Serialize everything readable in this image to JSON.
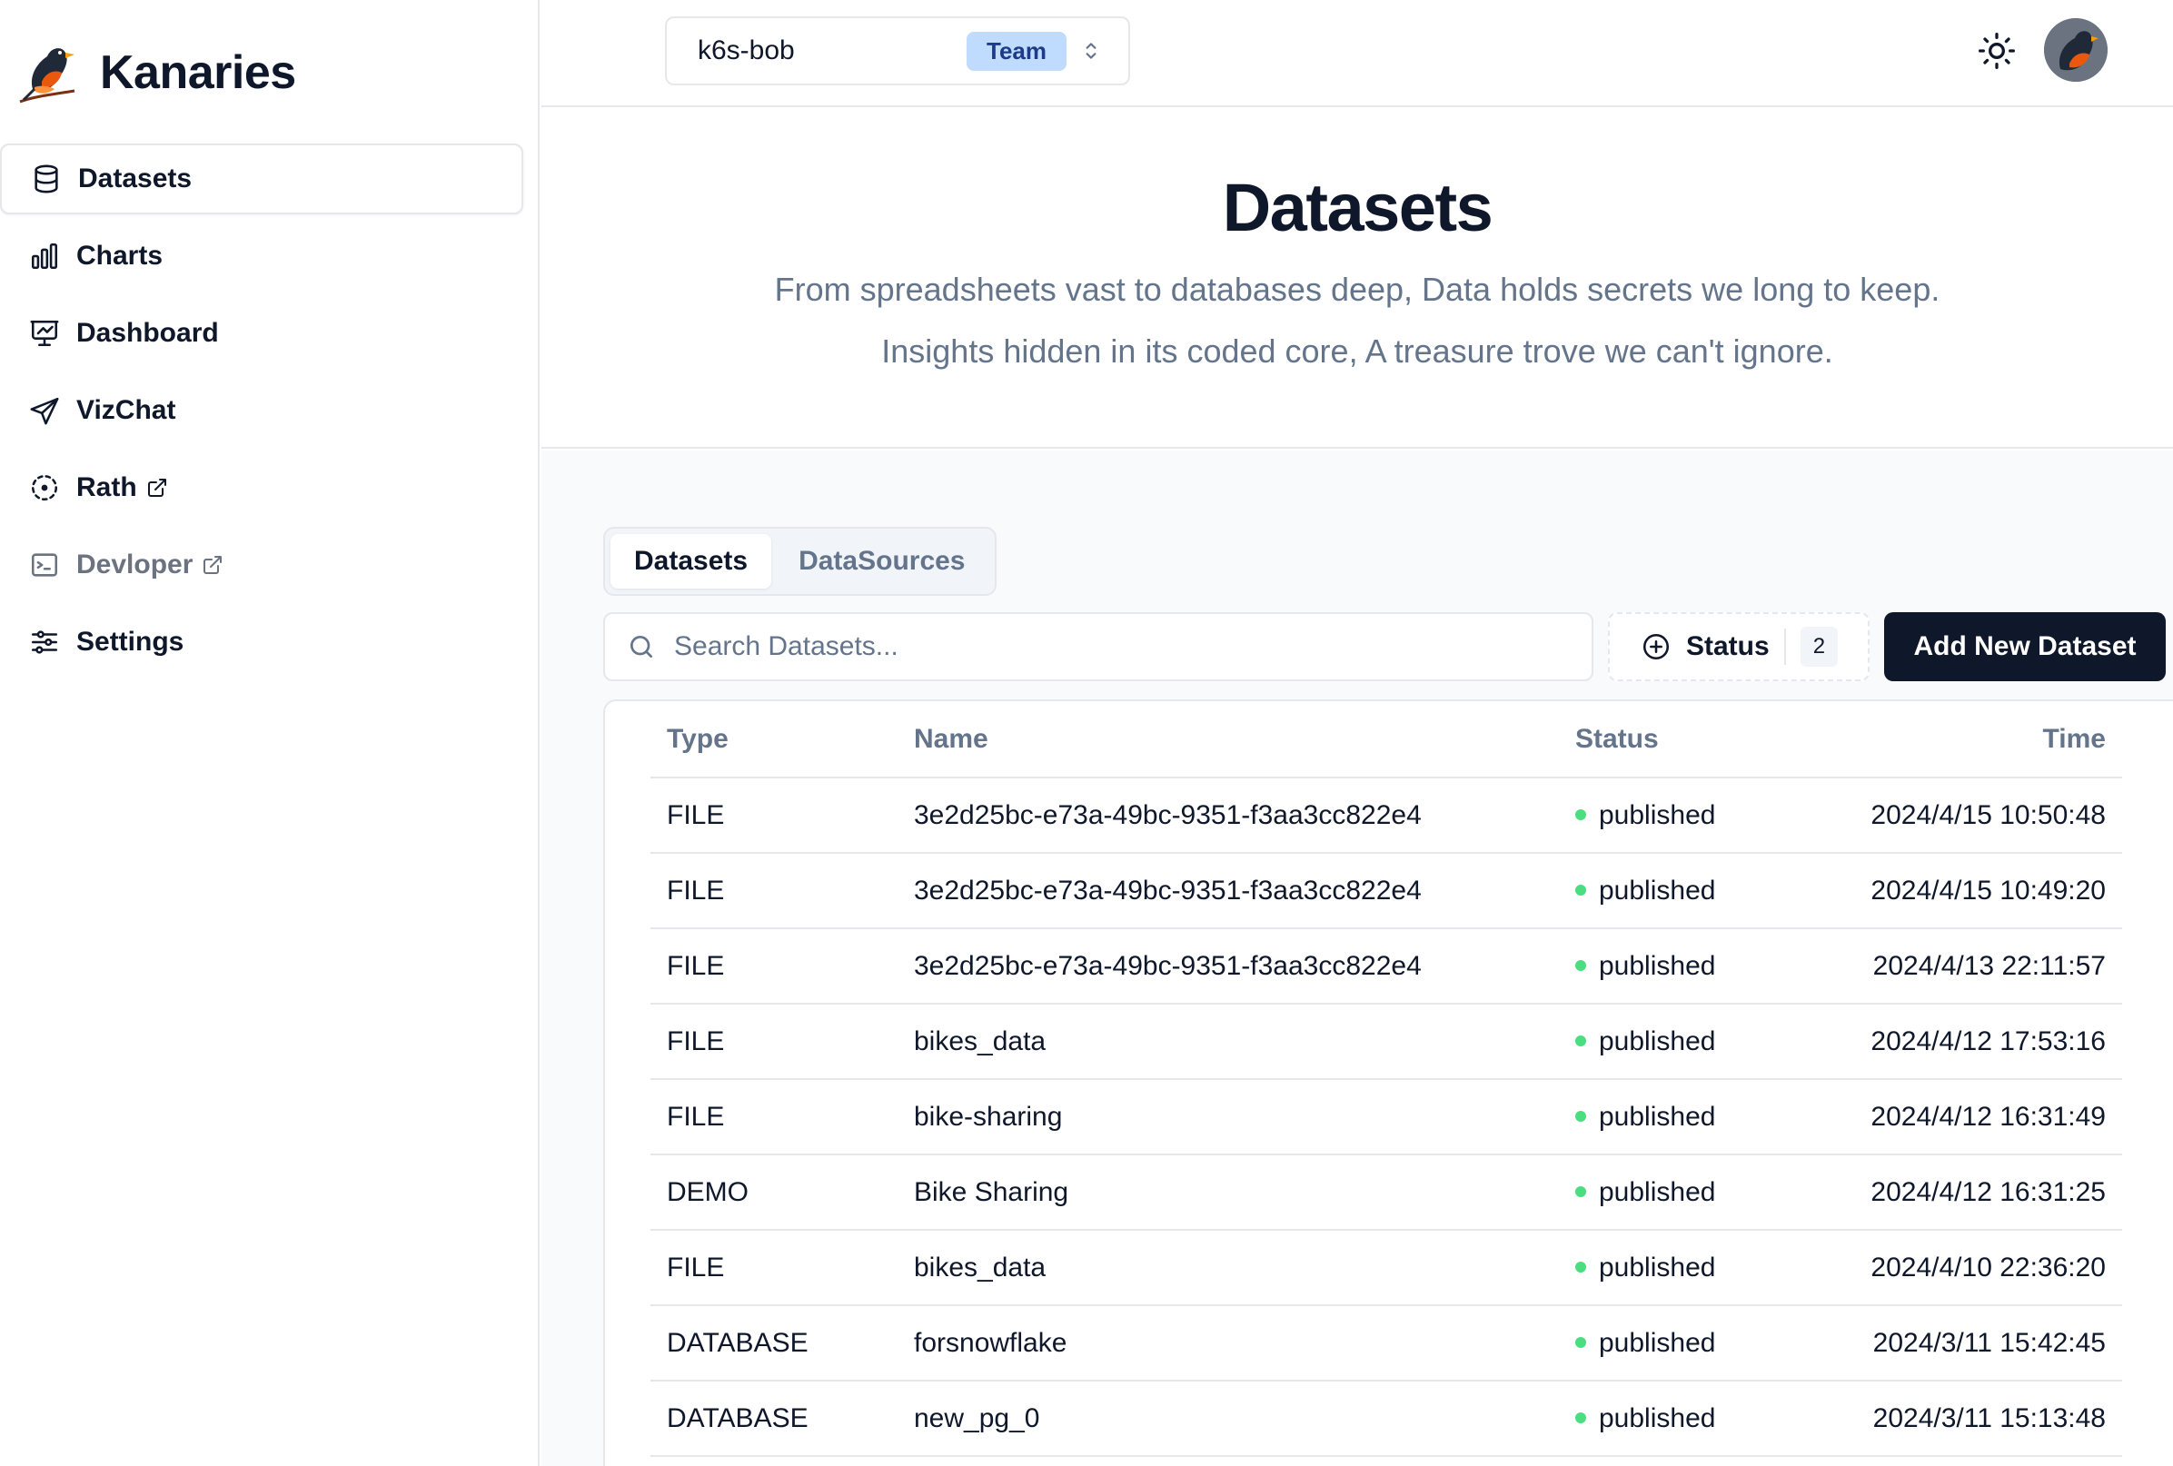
{
  "brand": {
    "name": "Kanaries"
  },
  "sidebar": {
    "items": [
      {
        "label": "Datasets",
        "icon": "database-icon",
        "active": true,
        "external": false,
        "muted": false
      },
      {
        "label": "Charts",
        "icon": "bar-chart-icon",
        "active": false,
        "external": false,
        "muted": false
      },
      {
        "label": "Dashboard",
        "icon": "presentation-chart-icon",
        "active": false,
        "external": false,
        "muted": false
      },
      {
        "label": "VizChat",
        "icon": "send-icon",
        "active": false,
        "external": false,
        "muted": false
      },
      {
        "label": "Rath",
        "icon": "dashed-circle-icon",
        "active": false,
        "external": true,
        "muted": false
      },
      {
        "label": "Devloper",
        "icon": "terminal-icon",
        "active": false,
        "external": true,
        "muted": true
      },
      {
        "label": "Settings",
        "icon": "sliders-icon",
        "active": false,
        "external": false,
        "muted": false
      }
    ]
  },
  "header": {
    "team": {
      "name": "k6s-bob",
      "badge": "Team"
    },
    "theme_icon": "sun-icon"
  },
  "hero": {
    "title": "Datasets",
    "line1": "From spreadsheets vast to databases deep, Data holds secrets we long to keep.",
    "line2": "Insights hidden in its coded core, A treasure trove we can't ignore."
  },
  "tabs": [
    {
      "label": "Datasets",
      "active": true
    },
    {
      "label": "DataSources",
      "active": false
    }
  ],
  "search": {
    "placeholder": "Search Datasets...",
    "value": ""
  },
  "status_filter": {
    "label": "Status",
    "count": "2"
  },
  "add_button": {
    "label": "Add New Dataset"
  },
  "table": {
    "columns": {
      "type": "Type",
      "name": "Name",
      "status": "Status",
      "time": "Time"
    },
    "rows": [
      {
        "type": "FILE",
        "name": "3e2d25bc-e73a-49bc-9351-f3aa3cc822e4",
        "status": "published",
        "time": "2024/4/15 10:50:48"
      },
      {
        "type": "FILE",
        "name": "3e2d25bc-e73a-49bc-9351-f3aa3cc822e4",
        "status": "published",
        "time": "2024/4/15 10:49:20"
      },
      {
        "type": "FILE",
        "name": "3e2d25bc-e73a-49bc-9351-f3aa3cc822e4",
        "status": "published",
        "time": "2024/4/13 22:11:57"
      },
      {
        "type": "FILE",
        "name": "bikes_data",
        "status": "published",
        "time": "2024/4/12 17:53:16"
      },
      {
        "type": "FILE",
        "name": "bike-sharing",
        "status": "published",
        "time": "2024/4/12 16:31:49"
      },
      {
        "type": "DEMO",
        "name": "Bike Sharing",
        "status": "published",
        "time": "2024/4/12 16:31:25"
      },
      {
        "type": "FILE",
        "name": "bikes_data",
        "status": "published",
        "time": "2024/4/10 22:36:20"
      },
      {
        "type": "DATABASE",
        "name": "forsnowflake",
        "status": "published",
        "time": "2024/3/11 15:42:45"
      },
      {
        "type": "DATABASE",
        "name": "new_pg_0",
        "status": "published",
        "time": "2024/3/11 15:13:48"
      }
    ]
  },
  "colors": {
    "primary": "#0f172a",
    "muted_text": "#64748b",
    "border": "#e5e7eb",
    "badge_bg": "#bfdbfe",
    "status_published": "#4ade80"
  }
}
